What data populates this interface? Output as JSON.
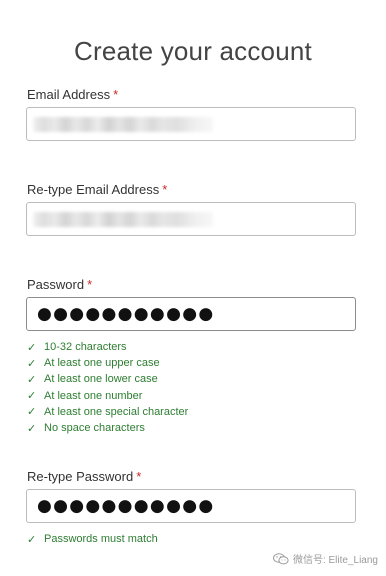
{
  "page": {
    "title": "Create your account"
  },
  "form": {
    "email": {
      "label": "Email Address",
      "required_mark": "*"
    },
    "retype_email": {
      "label": "Re-type Email Address",
      "required_mark": "*"
    },
    "password": {
      "label": "Password",
      "required_mark": "*",
      "masked_value": "●●●●●●●●●●●",
      "requirements": [
        "10-32 characters",
        "At least one upper case",
        "At least one lower case",
        "At least one number",
        "At least one special character",
        "No space characters"
      ]
    },
    "retype_password": {
      "label": "Re-type Password",
      "required_mark": "*",
      "masked_value": "●●●●●●●●●●●",
      "requirements": [
        "Passwords must match"
      ]
    }
  },
  "icons": {
    "check": "check-icon",
    "watermark": "wechat-icon"
  },
  "watermark": {
    "text": "微信号: Elite_Liang"
  },
  "colors": {
    "valid": "#2e7d32",
    "required": "#c62828"
  }
}
